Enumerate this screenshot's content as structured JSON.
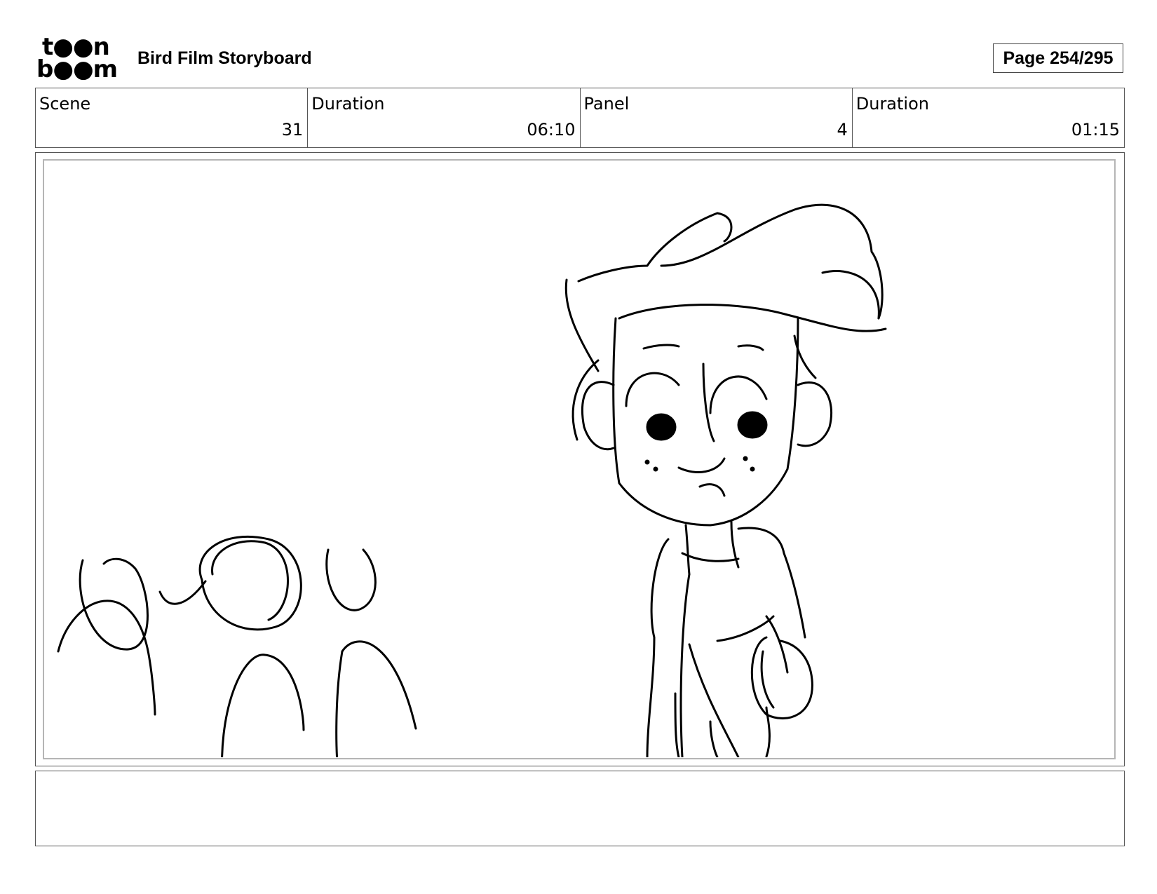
{
  "header": {
    "logo_line1": "t●●n",
    "logo_line2": "b●●m",
    "logo_icon": "toonboom-logo-icon",
    "title": "Bird Film Storyboard",
    "page": "Page 254/295"
  },
  "info": {
    "scene_label": "Scene",
    "scene_value": "31",
    "scene_duration_label": "Duration",
    "scene_duration_value": "06:10",
    "panel_label": "Panel",
    "panel_value": "4",
    "panel_duration_label": "Duration",
    "panel_duration_value": "01:15"
  },
  "notes": {
    "text": ""
  }
}
